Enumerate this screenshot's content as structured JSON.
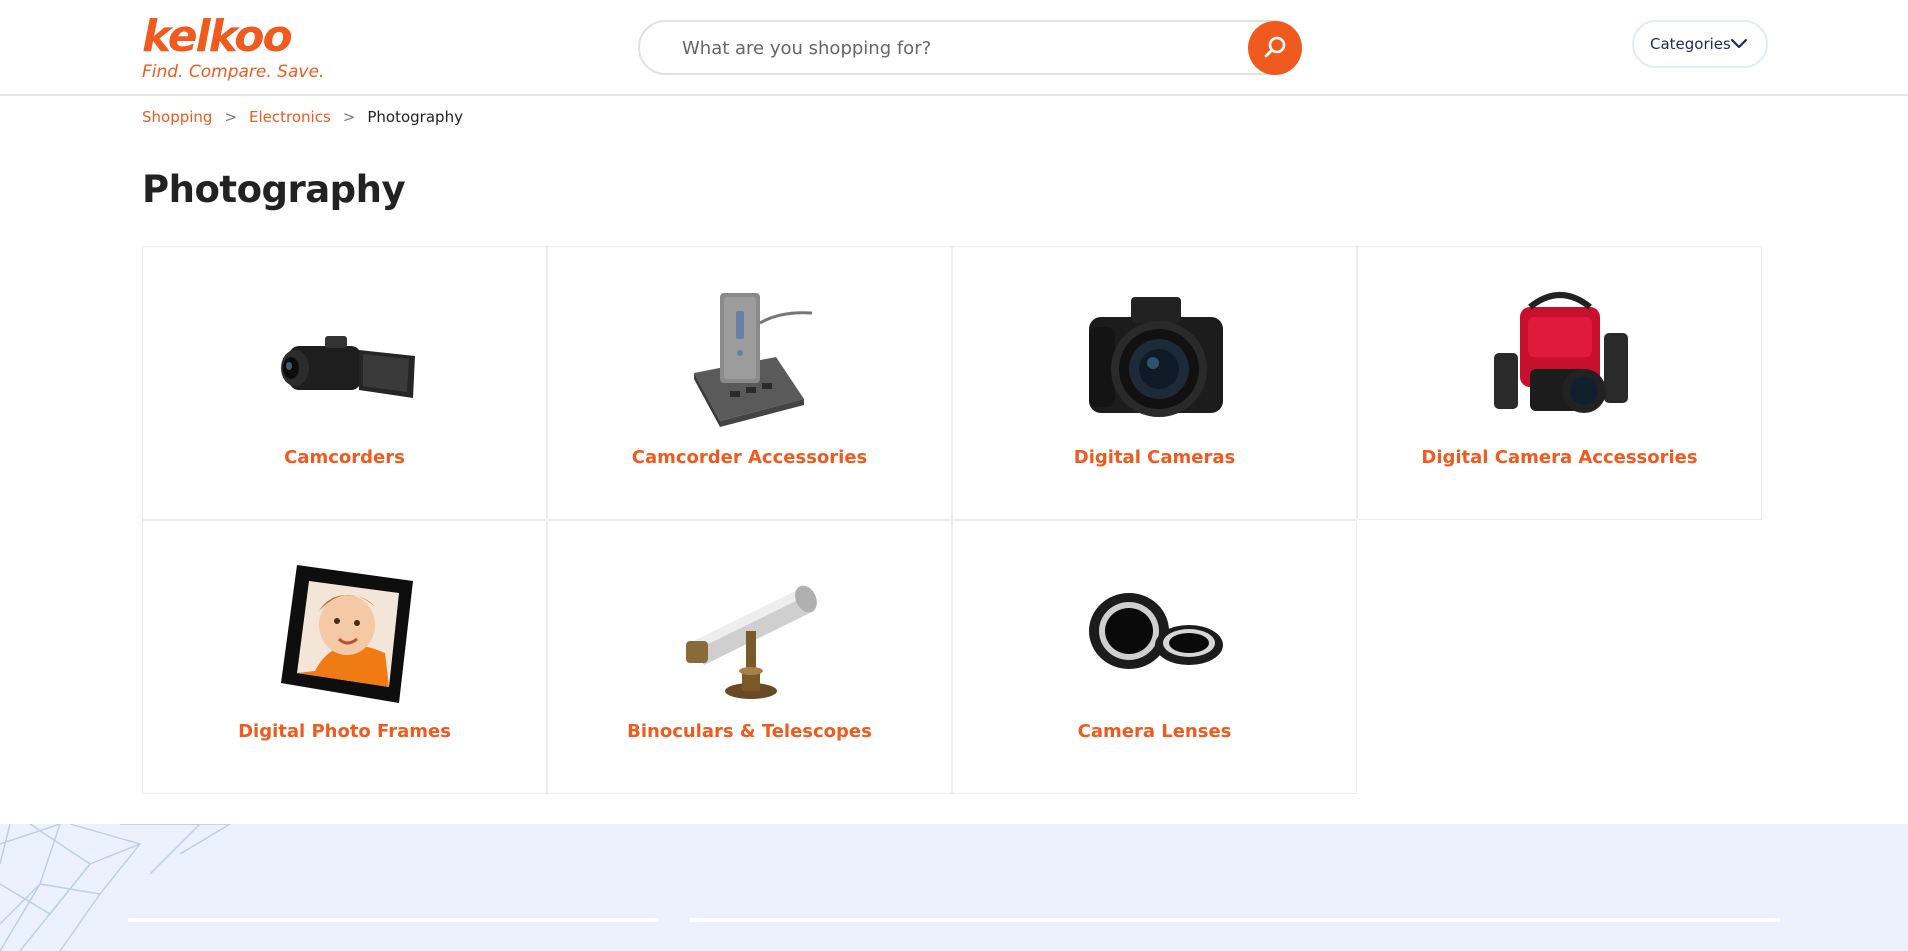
{
  "brand": {
    "name": "kelkoo",
    "tagline": "Find. Compare. Save.",
    "accent_color": "#f05a1e"
  },
  "search": {
    "placeholder": "What are you shopping for?",
    "value": "",
    "button_icon": "search-icon"
  },
  "header": {
    "categories_label": "Categories",
    "categories_icon": "chevron-down-icon"
  },
  "breadcrumb": {
    "items": [
      "Shopping",
      "Electronics"
    ],
    "current": "Photography",
    "separator": ">"
  },
  "page": {
    "title": "Photography"
  },
  "categories": [
    {
      "label": "Camcorders",
      "icon": "camcorder-image"
    },
    {
      "label": "Camcorder Accessories",
      "icon": "battery-charger-image"
    },
    {
      "label": "Digital Cameras",
      "icon": "dslr-camera-image"
    },
    {
      "label": "Digital Camera Accessories",
      "icon": "camera-bag-image"
    },
    {
      "label": "Digital Photo Frames",
      "icon": "photo-frame-image"
    },
    {
      "label": "Binoculars & Telescopes",
      "icon": "telescope-image"
    },
    {
      "label": "Camera Lenses",
      "icon": "lens-rings-image"
    }
  ]
}
